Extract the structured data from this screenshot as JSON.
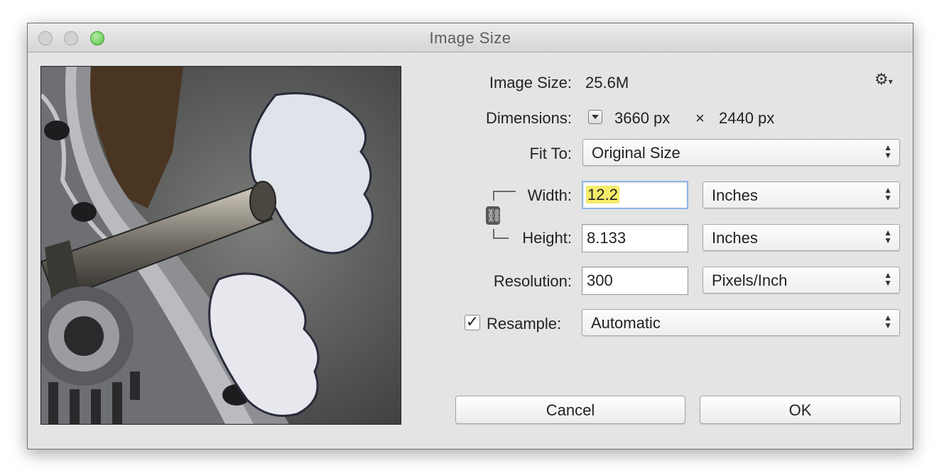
{
  "window": {
    "title": "Image Size"
  },
  "info": {
    "image_size_label": "Image Size:",
    "image_size_value": "25.6M",
    "dimensions_label": "Dimensions:",
    "dim_width": "3660 px",
    "dim_times": "×",
    "dim_height": "2440 px"
  },
  "fit_to": {
    "label": "Fit To:",
    "value": "Original Size"
  },
  "width": {
    "label": "Width:",
    "value": "12.2",
    "unit": "Inches"
  },
  "height": {
    "label": "Height:",
    "value": "8.133",
    "unit": "Inches"
  },
  "resolution": {
    "label": "Resolution:",
    "value": "300",
    "unit": "Pixels/Inch"
  },
  "resample": {
    "label": "Resample:",
    "value": "Automatic",
    "checked": true,
    "check_glyph": "✓"
  },
  "buttons": {
    "cancel": "Cancel",
    "ok": "OK"
  },
  "icons": {
    "settings": "gear-icon",
    "constrain": "chain-link-icon"
  },
  "colors": {
    "highlight": "#f5ec6a",
    "zoom_light": "#58c245",
    "focus_ring": "#8fb6e6"
  }
}
